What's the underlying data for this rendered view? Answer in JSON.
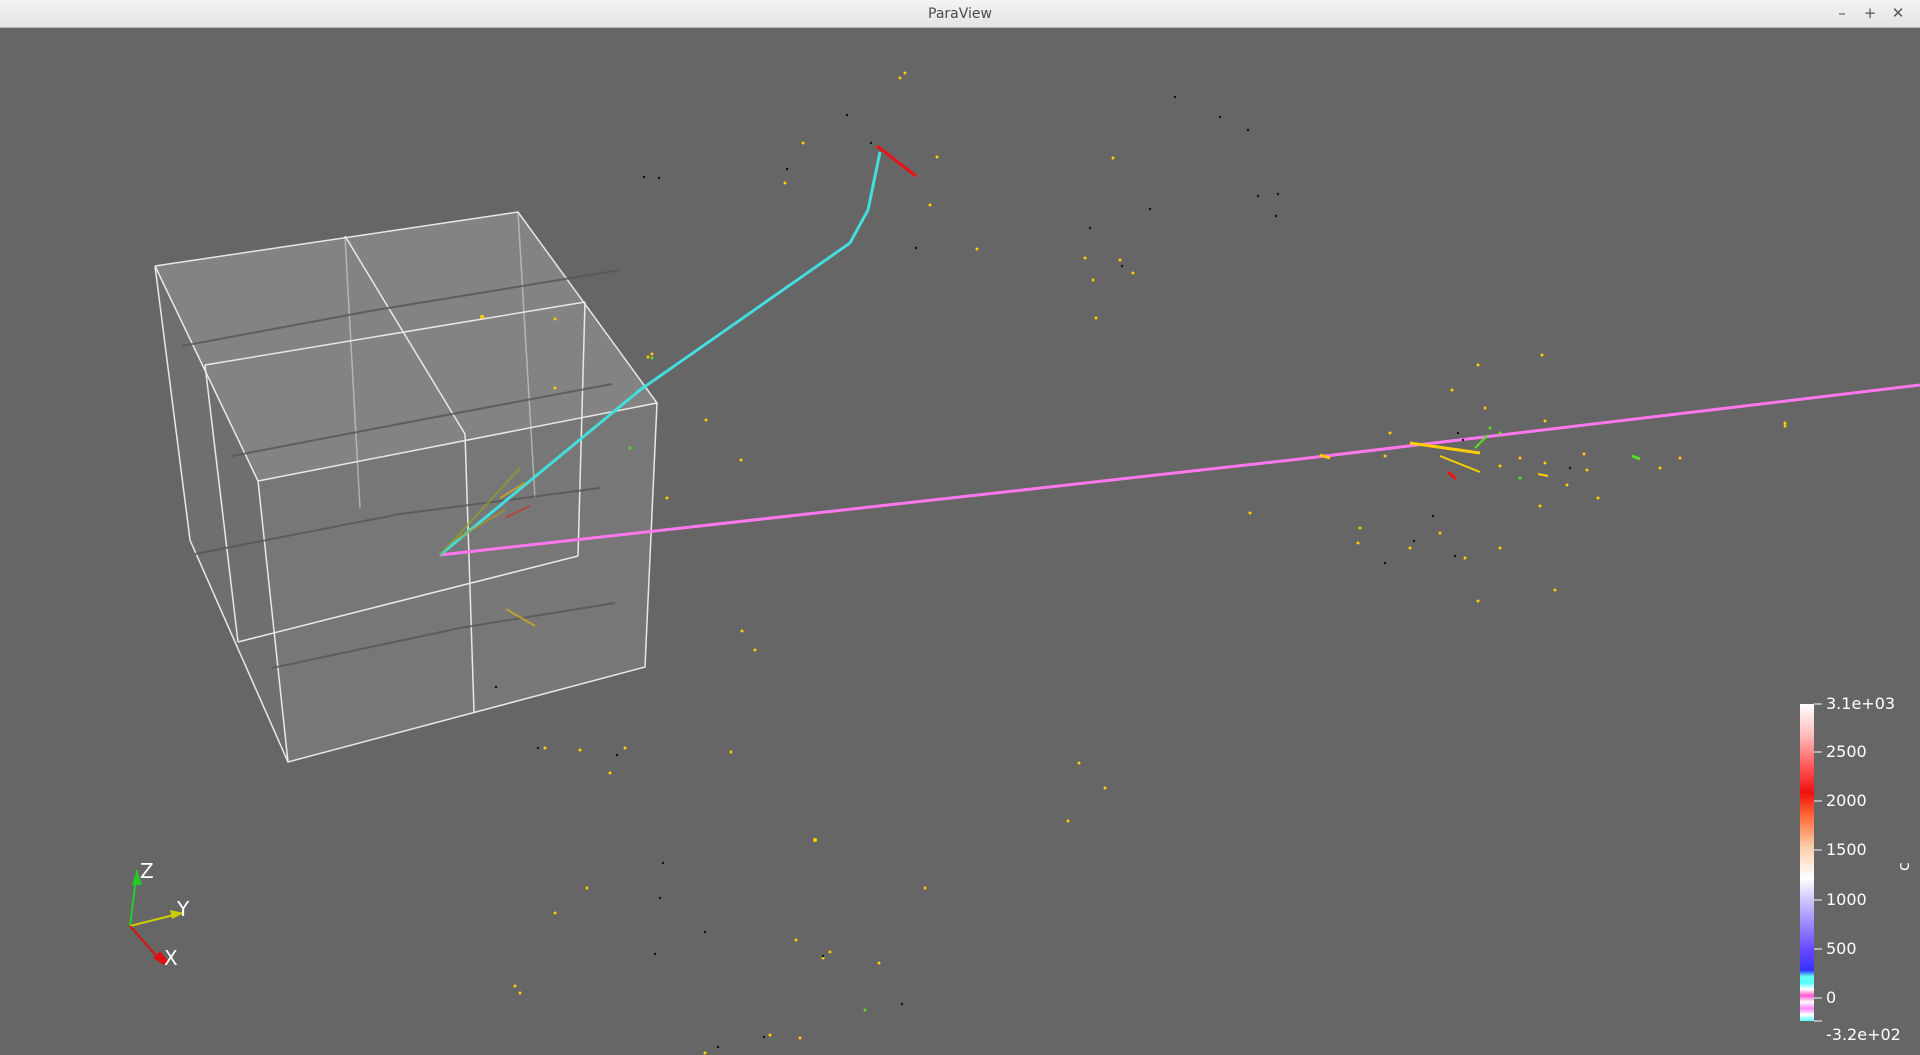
{
  "window": {
    "title": "ParaView",
    "controls": {
      "minimize": "–",
      "maximize": "+",
      "close": "✕"
    }
  },
  "scene": {
    "background": "#666666",
    "box_edge_color": "#e8e8e8",
    "track_colors": {
      "muon": "#ff77ee",
      "electron": "#44dddd",
      "short": "#ee1111",
      "hits_yellow": "#ffcc00",
      "hits_green": "#55dd22",
      "hits_black": "#111111"
    }
  },
  "orientation_axes": {
    "z_label": "Z",
    "y_label": "Y",
    "x_label": "X",
    "z_color": "#22cc22",
    "y_color": "#cccc00",
    "x_color": "#dd1111"
  },
  "color_legend": {
    "title": "c",
    "max_label": "3.1e+03",
    "min_label": "-3.2e+02",
    "ticks": [
      "2500",
      "2000",
      "1500",
      "1000",
      "500",
      "0"
    ],
    "value_min": -320,
    "value_max": 3100
  }
}
